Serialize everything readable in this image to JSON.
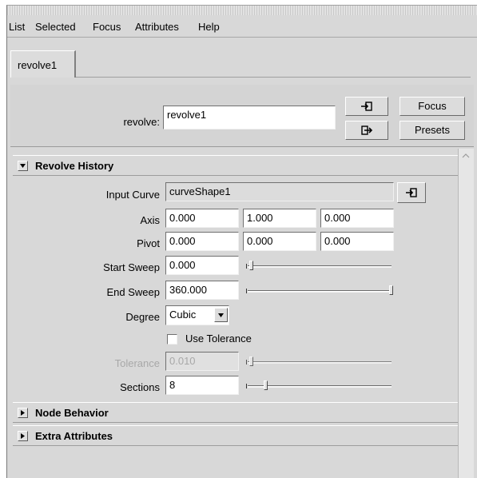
{
  "menu": [
    "List",
    "Selected",
    "Focus",
    "Attributes",
    "Help"
  ],
  "tab": {
    "label": "revolve1"
  },
  "header": {
    "node_label": "revolve:",
    "node_value": "revolve1",
    "focus_label": "Focus",
    "presets_label": "Presets",
    "load_icon": "load-attributes-icon",
    "copy_icon": "copy-tab-icon"
  },
  "sections": {
    "revolve_history": "Revolve History",
    "node_behavior": "Node Behavior",
    "extra_attributes": "Extra Attributes"
  },
  "attrs": {
    "input_curve": {
      "label": "Input Curve",
      "value": "curveShape1",
      "icon": "input-connection-icon"
    },
    "axis": {
      "label": "Axis",
      "x": "0.000",
      "y": "1.000",
      "z": "0.000"
    },
    "pivot": {
      "label": "Pivot",
      "x": "0.000",
      "y": "0.000",
      "z": "0.000"
    },
    "start_sweep": {
      "label": "Start Sweep",
      "value": "0.000",
      "slider_fraction": 0.0
    },
    "end_sweep": {
      "label": "End Sweep",
      "value": "360.000",
      "slider_fraction": 1.0
    },
    "degree": {
      "label": "Degree",
      "value": "Cubic"
    },
    "use_tolerance": {
      "label": "Use Tolerance",
      "checked": false
    },
    "tolerance": {
      "label": "Tolerance",
      "value": "0.010",
      "enabled": false,
      "slider_fraction": 0.0
    },
    "sections": {
      "label": "Sections",
      "value": "8",
      "slider_fraction": 0.1
    }
  },
  "colors": {
    "panel_bg": "#d8d8d8",
    "field_bg": "#ffffff",
    "disabled_text": "#a8a8a8"
  }
}
